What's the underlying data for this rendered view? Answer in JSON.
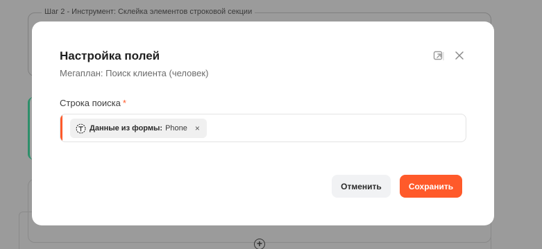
{
  "background": {
    "step_legend": "Шаг 2 - Инструмент: Склейка элементов строковой секции"
  },
  "modal": {
    "title": "Настройка полей",
    "subtitle": "Мегаплан: Поиск клиента (человек)",
    "field": {
      "label": "Строка поиска",
      "required_mark": "*",
      "chip": {
        "source": "Данные из формы:",
        "value": "Phone",
        "remove": "×"
      }
    },
    "buttons": {
      "cancel": "Отменить",
      "save": "Сохранить"
    }
  },
  "colors": {
    "accent": "#ff5a2a",
    "cancel_bg": "#f1f2f4"
  },
  "icons": {
    "expand": "external-window-icon",
    "close": "close-icon",
    "chip": "text-t-icon",
    "background_add": "plus-circle-icon"
  }
}
